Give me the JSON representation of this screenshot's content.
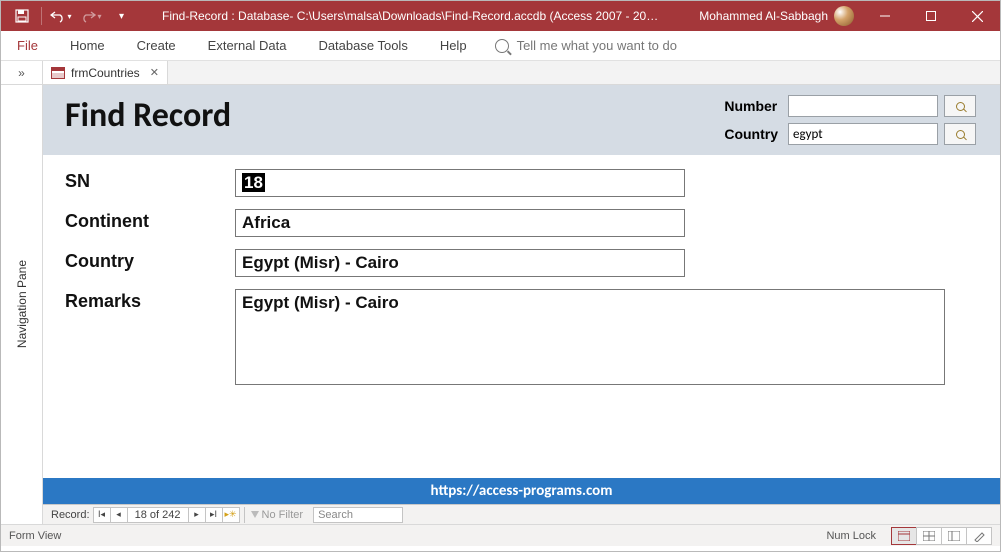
{
  "titlebar": {
    "app_title": "Find-Record : Database- C:\\Users\\malsa\\Downloads\\Find-Record.accdb (Access 2007 - 20…",
    "user_name": "Mohammed Al-Sabbagh"
  },
  "ribbon": {
    "tabs": {
      "file": "File",
      "home": "Home",
      "create": "Create",
      "external": "External Data",
      "tools": "Database Tools",
      "help": "Help"
    },
    "tell_me": "Tell me what you want to do"
  },
  "doc_tab": {
    "name": "frmCountries"
  },
  "navpane": {
    "label": "Navigation Pane"
  },
  "form": {
    "title": "Find Record",
    "search": {
      "number_label": "Number",
      "number_value": "",
      "country_label": "Country",
      "country_value": "egypt"
    },
    "fields": {
      "sn_label": "SN",
      "sn_value": "18",
      "continent_label": "Continent",
      "continent_value": "Africa",
      "country_label": "Country",
      "country_value": "Egypt (Misr) - Cairo",
      "remarks_label": "Remarks",
      "remarks_value": "Egypt (Misr) - Cairo"
    },
    "footer_link": "https://access-programs.com"
  },
  "recnav": {
    "label": "Record:",
    "position": "18 of 242",
    "filter": "No Filter",
    "search_placeholder": "Search"
  },
  "statusbar": {
    "left": "Form View",
    "numlock": "Num Lock"
  }
}
